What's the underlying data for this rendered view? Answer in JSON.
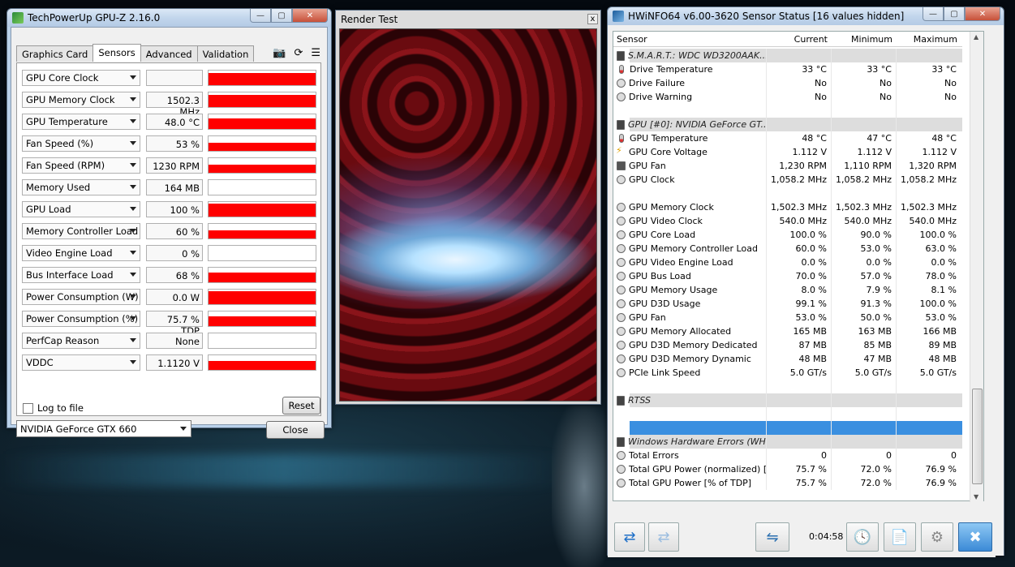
{
  "gpuz": {
    "title": "TechPowerUp GPU-Z 2.16.0",
    "tabs": [
      "Graphics Card",
      "Sensors",
      "Advanced",
      "Validation"
    ],
    "sensors": [
      {
        "name": "GPU Core Clock",
        "value": "",
        "level": 0.85
      },
      {
        "name": "GPU Memory Clock",
        "value": "1502.3 MHz",
        "level": 0.85
      },
      {
        "name": "GPU Temperature",
        "value": "48.0 °C",
        "level": 0.75
      },
      {
        "name": "Fan Speed (%)",
        "value": "53 %",
        "level": 0.55
      },
      {
        "name": "Fan Speed (RPM)",
        "value": "1230 RPM",
        "level": 0.55
      },
      {
        "name": "Memory Used",
        "value": "164 MB",
        "level": 0.0
      },
      {
        "name": "GPU Load",
        "value": "100 %",
        "level": 0.9
      },
      {
        "name": "Memory Controller Load",
        "value": "60 %",
        "level": 0.55
      },
      {
        "name": "Video Engine Load",
        "value": "0 %",
        "level": 0.0
      },
      {
        "name": "Bus Interface Load",
        "value": "68 %",
        "level": 0.65
      },
      {
        "name": "Power Consumption (W)",
        "value": "0.0 W",
        "level": 0.9
      },
      {
        "name": "Power Consumption (%)",
        "value": "75.7 % TDP",
        "level": 0.65
      },
      {
        "name": "PerfCap Reason",
        "value": "None",
        "level": 0.0
      },
      {
        "name": "VDDC",
        "value": "1.1120 V",
        "level": 0.6
      }
    ],
    "log_to_file": "Log to file",
    "reset": "Reset",
    "gpu_select": "NVIDIA GeForce GTX 660",
    "close": "Close"
  },
  "render": {
    "title": "Render Test",
    "close": "x"
  },
  "hwinfo": {
    "title": "HWiNFO64 v6.00-3620 Sensor Status [16 values hidden]",
    "columns": [
      "Sensor",
      "Current",
      "Minimum",
      "Maximum"
    ],
    "rows": [
      {
        "type": "group",
        "icon": "chip",
        "label": "S.M.A.R.T.: WDC WD3200AAK..."
      },
      {
        "icon": "therm",
        "label": "Drive Temperature",
        "cur": "33 °C",
        "min": "33 °C",
        "max": "33 °C"
      },
      {
        "icon": "circle",
        "label": "Drive Failure",
        "cur": "No",
        "min": "No",
        "max": "No"
      },
      {
        "icon": "circle",
        "label": "Drive Warning",
        "cur": "No",
        "min": "No",
        "max": "No"
      },
      {
        "type": "blank"
      },
      {
        "type": "group",
        "icon": "chip",
        "label": "GPU [#0]: NVIDIA GeForce GT..."
      },
      {
        "icon": "therm",
        "label": "GPU Temperature",
        "cur": "48 °C",
        "min": "47 °C",
        "max": "48 °C"
      },
      {
        "icon": "bolt",
        "label": "GPU Core Voltage",
        "cur": "1.112 V",
        "min": "1.112 V",
        "max": "1.112 V"
      },
      {
        "icon": "fan",
        "label": "GPU Fan",
        "cur": "1,230 RPM",
        "min": "1,110 RPM",
        "max": "1,320 RPM"
      },
      {
        "icon": "circle",
        "label": "GPU Clock",
        "cur": "1,058.2 MHz",
        "min": "1,058.2 MHz",
        "max": "1,058.2 MHz"
      },
      {
        "type": "blank"
      },
      {
        "icon": "circle",
        "label": "GPU Memory Clock",
        "cur": "1,502.3 MHz",
        "min": "1,502.3 MHz",
        "max": "1,502.3 MHz"
      },
      {
        "icon": "circle",
        "label": "GPU Video Clock",
        "cur": "540.0 MHz",
        "min": "540.0 MHz",
        "max": "540.0 MHz"
      },
      {
        "icon": "circle",
        "label": "GPU Core Load",
        "cur": "100.0 %",
        "min": "90.0 %",
        "max": "100.0 %"
      },
      {
        "icon": "circle",
        "label": "GPU Memory Controller Load",
        "cur": "60.0 %",
        "min": "53.0 %",
        "max": "63.0 %"
      },
      {
        "icon": "circle",
        "label": "GPU Video Engine Load",
        "cur": "0.0 %",
        "min": "0.0 %",
        "max": "0.0 %"
      },
      {
        "icon": "circle",
        "label": "GPU Bus Load",
        "cur": "70.0 %",
        "min": "57.0 %",
        "max": "78.0 %"
      },
      {
        "icon": "circle",
        "label": "GPU Memory Usage",
        "cur": "8.0 %",
        "min": "7.9 %",
        "max": "8.1 %"
      },
      {
        "icon": "circle",
        "label": "GPU D3D Usage",
        "cur": "99.1 %",
        "min": "91.3 %",
        "max": "100.0 %"
      },
      {
        "icon": "circle",
        "label": "GPU Fan",
        "cur": "53.0 %",
        "min": "50.0 %",
        "max": "53.0 %"
      },
      {
        "icon": "circle",
        "label": "GPU Memory Allocated",
        "cur": "165 MB",
        "min": "163 MB",
        "max": "166 MB"
      },
      {
        "icon": "circle",
        "label": "GPU D3D Memory Dedicated",
        "cur": "87 MB",
        "min": "85 MB",
        "max": "89 MB"
      },
      {
        "icon": "circle",
        "label": "GPU D3D Memory Dynamic",
        "cur": "48 MB",
        "min": "47 MB",
        "max": "48 MB"
      },
      {
        "icon": "circle",
        "label": "PCIe Link Speed",
        "cur": "5.0 GT/s",
        "min": "5.0 GT/s",
        "max": "5.0 GT/s"
      },
      {
        "type": "blank"
      },
      {
        "type": "group",
        "icon": "chip",
        "label": "RTSS"
      },
      {
        "type": "blank"
      },
      {
        "type": "sel"
      },
      {
        "type": "group",
        "icon": "chip",
        "label": "Windows Hardware Errors (WH..."
      },
      {
        "icon": "circle",
        "label": "Total Errors",
        "cur": "0",
        "min": "0",
        "max": "0"
      },
      {
        "icon": "circle",
        "label": "Total GPU Power (normalized) [...",
        "cur": "75.7 %",
        "min": "72.0 %",
        "max": "76.9 %"
      },
      {
        "icon": "circle",
        "label": "Total GPU Power [% of TDP]",
        "cur": "75.7 %",
        "min": "72.0 %",
        "max": "76.9 %"
      }
    ],
    "timer": "0:04:58"
  }
}
